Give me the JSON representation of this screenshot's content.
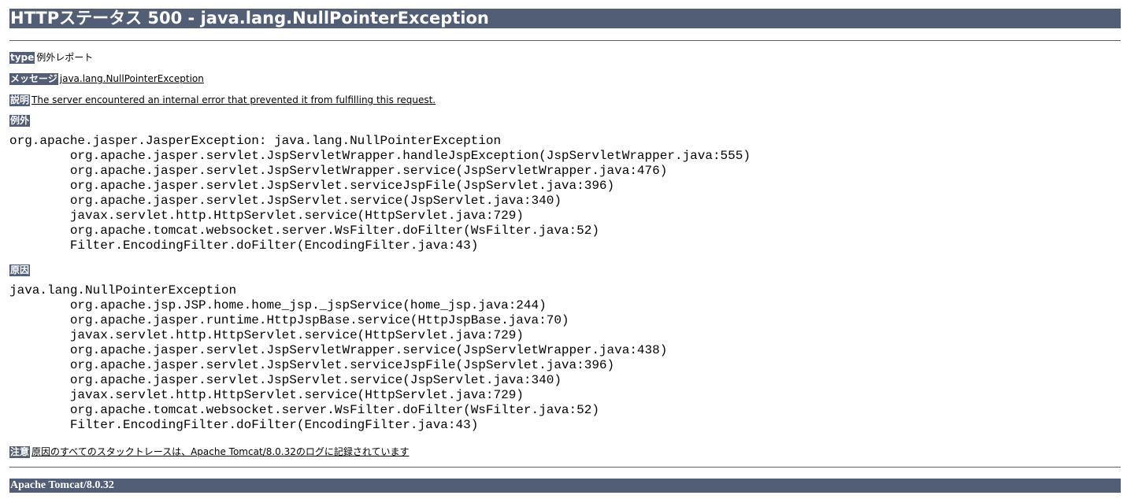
{
  "header": {
    "title": "HTTPステータス 500 - java.lang.NullPointerException"
  },
  "report": {
    "type_label": "type",
    "type_value": "例外レポート",
    "message_label": "メッセージ",
    "message_value": "java.lang.NullPointerException",
    "description_label": "説明",
    "description_value": "The server encountered an internal error that prevented it from fulfilling this request.",
    "exception_label": "例外",
    "exception_trace": "org.apache.jasper.JasperException: java.lang.NullPointerException\n\torg.apache.jasper.servlet.JspServletWrapper.handleJspException(JspServletWrapper.java:555)\n\torg.apache.jasper.servlet.JspServletWrapper.service(JspServletWrapper.java:476)\n\torg.apache.jasper.servlet.JspServlet.serviceJspFile(JspServlet.java:396)\n\torg.apache.jasper.servlet.JspServlet.service(JspServlet.java:340)\n\tjavax.servlet.http.HttpServlet.service(HttpServlet.java:729)\n\torg.apache.tomcat.websocket.server.WsFilter.doFilter(WsFilter.java:52)\n\tFilter.EncodingFilter.doFilter(EncodingFilter.java:43)",
    "cause_label": "原因",
    "cause_trace": "java.lang.NullPointerException\n\torg.apache.jsp.JSP.home.home_jsp._jspService(home_jsp.java:244)\n\torg.apache.jasper.runtime.HttpJspBase.service(HttpJspBase.java:70)\n\tjavax.servlet.http.HttpServlet.service(HttpServlet.java:729)\n\torg.apache.jasper.servlet.JspServletWrapper.service(JspServletWrapper.java:438)\n\torg.apache.jasper.servlet.JspServlet.serviceJspFile(JspServlet.java:396)\n\torg.apache.jasper.servlet.JspServlet.service(JspServlet.java:340)\n\tjavax.servlet.http.HttpServlet.service(HttpServlet.java:729)\n\torg.apache.tomcat.websocket.server.WsFilter.doFilter(WsFilter.java:52)\n\tFilter.EncodingFilter.doFilter(EncodingFilter.java:43)",
    "note_label": "注意",
    "note_value": "原因のすべてのスタックトレースは、Apache Tomcat/8.0.32のログに記録されています"
  },
  "footer": {
    "server_version": "Apache Tomcat/8.0.32"
  },
  "colors": {
    "label_background": "#525D76",
    "label_text": "#ffffff"
  }
}
